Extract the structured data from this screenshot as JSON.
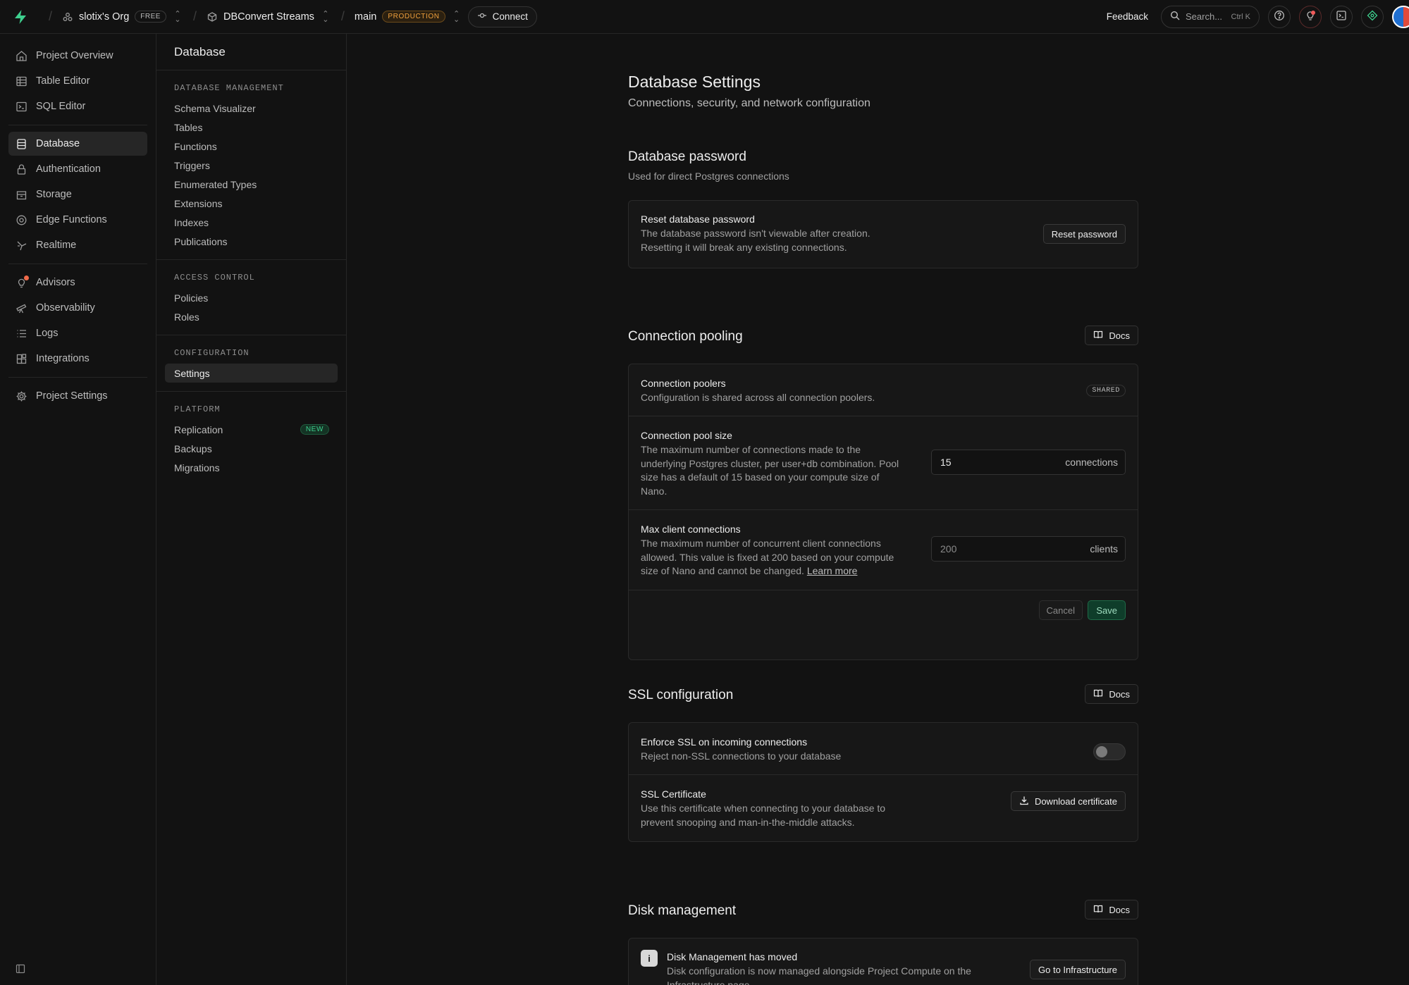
{
  "topbar": {
    "org_name": "slotix's Org",
    "org_plan": "FREE",
    "project_name": "DBConvert Streams",
    "branch_name": "main",
    "branch_env": "PRODUCTION",
    "connect_label": "Connect",
    "feedback_label": "Feedback",
    "search_placeholder": "Search...",
    "search_shortcut": "Ctrl K"
  },
  "leftnav": {
    "group1": [
      {
        "label": "Project Overview",
        "icon": "home-icon"
      },
      {
        "label": "Table Editor",
        "icon": "table-icon"
      },
      {
        "label": "SQL Editor",
        "icon": "terminal-icon"
      }
    ],
    "group2": [
      {
        "label": "Database",
        "icon": "database-icon",
        "active": true
      },
      {
        "label": "Authentication",
        "icon": "lock-icon"
      },
      {
        "label": "Storage",
        "icon": "archive-icon"
      },
      {
        "label": "Edge Functions",
        "icon": "edge-function-icon"
      },
      {
        "label": "Realtime",
        "icon": "realtime-icon"
      }
    ],
    "group3": [
      {
        "label": "Advisors",
        "icon": "lightbulb-icon"
      },
      {
        "label": "Observability",
        "icon": "telescope-icon"
      },
      {
        "label": "Logs",
        "icon": "list-icon"
      },
      {
        "label": "Integrations",
        "icon": "blocks-icon"
      }
    ],
    "group4": [
      {
        "label": "Project Settings",
        "icon": "gear-icon"
      }
    ]
  },
  "subnav": {
    "title": "Database",
    "sections": [
      {
        "heading": "DATABASE MANAGEMENT",
        "items": [
          "Schema Visualizer",
          "Tables",
          "Functions",
          "Triggers",
          "Enumerated Types",
          "Extensions",
          "Indexes",
          "Publications"
        ]
      },
      {
        "heading": "ACCESS CONTROL",
        "items": [
          "Policies",
          "Roles"
        ]
      },
      {
        "heading": "CONFIGURATION",
        "items": [
          "Settings"
        ]
      },
      {
        "heading": "PLATFORM",
        "items": [
          "Replication",
          "Backups",
          "Migrations"
        ]
      }
    ],
    "new_badge": "NEW"
  },
  "page": {
    "title": "Database Settings",
    "subtitle": "Connections, security, and network configuration"
  },
  "password": {
    "title": "Database password",
    "subtitle": "Used for direct Postgres connections",
    "row_title": "Reset database password",
    "row_desc_1": "The database password isn't viewable after creation.",
    "row_desc_2": "Resetting it will break any existing connections.",
    "button": "Reset password"
  },
  "pooling": {
    "title": "Connection pooling",
    "docs": "Docs",
    "poolers_title": "Connection poolers",
    "poolers_desc": "Configuration is shared across all connection poolers.",
    "poolers_badge": "SHARED",
    "pool_size_title": "Connection pool size",
    "pool_size_desc_1": "The maximum number of connections made to the",
    "pool_size_desc_2": "underlying Postgres cluster, per user+db combination. Pool",
    "pool_size_desc_3": "size has a default of 15 based on your compute size of",
    "pool_size_desc_4": "Nano.",
    "pool_size_value": "15",
    "pool_size_unit": "connections",
    "max_client_title": "Max client connections",
    "max_client_desc_1": "The maximum number of concurrent client connections",
    "max_client_desc_2": "allowed. This value is fixed at 200 based on your compute",
    "max_client_desc_3": "size of Nano and cannot be changed.",
    "learn_more": "Learn more",
    "max_client_value": "200",
    "max_client_unit": "clients",
    "cancel": "Cancel",
    "save": "Save"
  },
  "ssl": {
    "title": "SSL configuration",
    "docs": "Docs",
    "enforce_title": "Enforce SSL on incoming connections",
    "enforce_desc": "Reject non-SSL connections to your database",
    "enforce_enabled": false,
    "cert_title": "SSL Certificate",
    "cert_desc_1": "Use this certificate when connecting to your database to",
    "cert_desc_2": "prevent snooping and man-in-the-middle attacks.",
    "cert_button": "Download certificate"
  },
  "disk": {
    "title": "Disk management",
    "docs": "Docs",
    "notice_title": "Disk Management has moved",
    "notice_desc_1": "Disk configuration is now managed alongside Project Compute on the",
    "notice_desc_2": "Infrastructure page.",
    "button": "Go to Infrastructure"
  },
  "colors": {
    "brand": "#3ecf8e",
    "background": "#121212",
    "production_badge": "#f0a03c"
  }
}
